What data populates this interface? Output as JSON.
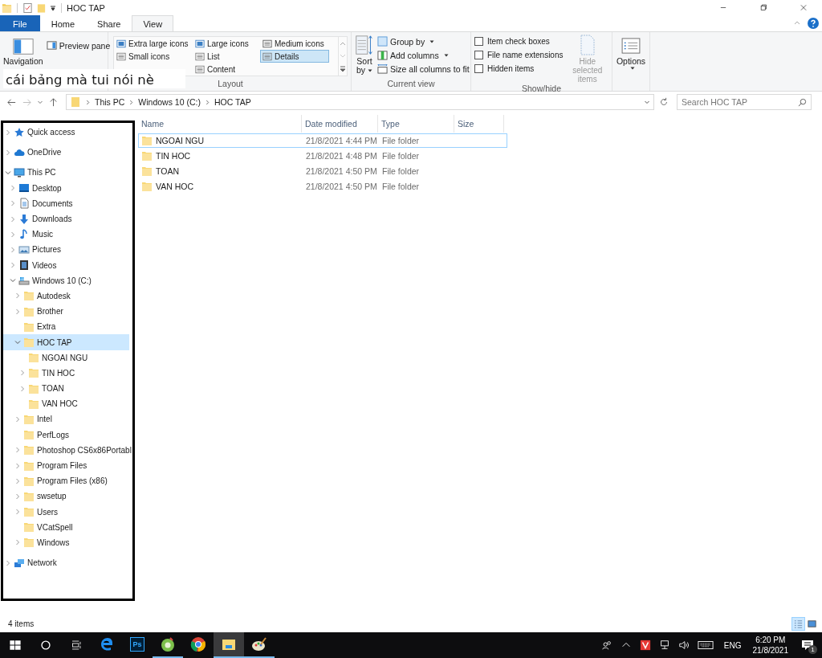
{
  "window": {
    "title": "HOC TAP"
  },
  "ribbon_tabs": [
    {
      "label": "File",
      "kind": "file",
      "selected": false
    },
    {
      "label": "Home",
      "kind": "tab",
      "selected": false
    },
    {
      "label": "Share",
      "kind": "tab",
      "selected": false
    },
    {
      "label": "View",
      "kind": "tab",
      "selected": true
    }
  ],
  "annotation": {
    "text": "cái bảng mà tui nói nè"
  },
  "panes_group": {
    "navigation_pane": "Navigation",
    "preview_pane": "Preview pane"
  },
  "layout_group": {
    "label": "Layout",
    "options": [
      {
        "label": "Extra large icons",
        "kind": "xl",
        "selected": false
      },
      {
        "label": "Large icons",
        "kind": "large",
        "selected": false
      },
      {
        "label": "Medium icons",
        "kind": "medium",
        "selected": false
      },
      {
        "label": "Small icons",
        "kind": "small",
        "selected": false
      },
      {
        "label": "List",
        "kind": "list",
        "selected": false
      },
      {
        "label": "Details",
        "kind": "details",
        "selected": true
      },
      {
        "label": "Content",
        "kind": "content",
        "selected": false
      }
    ]
  },
  "current_view_group": {
    "label": "Current view",
    "sort_by": "Sort",
    "sort_by_2": "by",
    "group_by": "Group by",
    "add_columns": "Add columns",
    "size_columns": "Size all columns to fit"
  },
  "show_hide_group": {
    "label": "Show/hide",
    "checkboxes": [
      {
        "label": "Item check boxes",
        "checked": false
      },
      {
        "label": "File name extensions",
        "checked": false
      },
      {
        "label": "Hidden items",
        "checked": false
      }
    ],
    "hide_selected": "Hide selected items"
  },
  "options_button": "Options",
  "address_bar": {
    "path": [
      "This PC",
      "Windows 10 (C:)",
      "HOC TAP"
    ]
  },
  "search": {
    "placeholder": "Search HOC TAP"
  },
  "nav_tree": [
    {
      "label": "Quick access",
      "kind": "star",
      "expanded": false
    },
    {
      "label": "OneDrive",
      "kind": "cloud",
      "expanded": false
    },
    {
      "label": "This PC",
      "kind": "pc",
      "expanded": true,
      "children": [
        {
          "label": "Desktop",
          "kind": "desktop",
          "expanded": false
        },
        {
          "label": "Documents",
          "kind": "documents",
          "expanded": false
        },
        {
          "label": "Downloads",
          "kind": "downloads",
          "expanded": false
        },
        {
          "label": "Music",
          "kind": "music",
          "expanded": false
        },
        {
          "label": "Pictures",
          "kind": "pictures",
          "expanded": false
        },
        {
          "label": "Videos",
          "kind": "videos",
          "expanded": false
        },
        {
          "label": "Windows 10 (C:)",
          "kind": "drive",
          "expanded": true,
          "children": [
            {
              "label": "Autodesk",
              "kind": "folder",
              "expanded": false
            },
            {
              "label": "Brother",
              "kind": "folder",
              "expanded": false
            },
            {
              "label": "Extra",
              "kind": "folder"
            },
            {
              "label": "HOC TAP",
              "kind": "folder",
              "expanded": true,
              "selected": true,
              "children": [
                {
                  "label": "NGOAI NGU",
                  "kind": "folder"
                },
                {
                  "label": "TIN HOC",
                  "kind": "folder",
                  "expanded": false
                },
                {
                  "label": "TOAN",
                  "kind": "folder",
                  "expanded": false
                },
                {
                  "label": "VAN HOC",
                  "kind": "folder"
                }
              ]
            },
            {
              "label": "Intel",
              "kind": "folder",
              "expanded": false
            },
            {
              "label": "PerfLogs",
              "kind": "folder"
            },
            {
              "label": "Photoshop CS6x86Portabl",
              "kind": "folder",
              "expanded": false
            },
            {
              "label": "Program Files",
              "kind": "folder",
              "expanded": false
            },
            {
              "label": "Program Files (x86)",
              "kind": "folder",
              "expanded": false
            },
            {
              "label": "swsetup",
              "kind": "folder",
              "expanded": false
            },
            {
              "label": "Users",
              "kind": "folder",
              "expanded": false
            },
            {
              "label": "VCatSpell",
              "kind": "folder"
            },
            {
              "label": "Windows",
              "kind": "folder",
              "expanded": false
            }
          ]
        }
      ]
    },
    {
      "label": "Network",
      "kind": "network",
      "expanded": false
    }
  ],
  "file_list": {
    "columns": [
      "Name",
      "Date modified",
      "Type",
      "Size"
    ],
    "rows": [
      {
        "name": "NGOAI NGU",
        "date_modified": "21/8/2021 4:44 PM",
        "type": "File folder",
        "focused": true
      },
      {
        "name": "TIN HOC",
        "date_modified": "21/8/2021 4:48 PM",
        "type": "File folder",
        "focused": false
      },
      {
        "name": "TOAN",
        "date_modified": "21/8/2021 4:50 PM",
        "type": "File folder",
        "focused": false
      },
      {
        "name": "VAN HOC",
        "date_modified": "21/8/2021 4:50 PM",
        "type": "File folder",
        "focused": false
      }
    ]
  },
  "status_bar": {
    "item_count": "4 items",
    "view_buttons": [
      {
        "kind": "details",
        "selected": true
      },
      {
        "kind": "large",
        "selected": false
      }
    ]
  },
  "taskbar": {
    "apps": [
      {
        "kind": "edge",
        "running": false,
        "active": false
      },
      {
        "kind": "photoshop",
        "label": "Ps",
        "running": false,
        "active": false
      },
      {
        "kind": "green",
        "running": true,
        "active": false
      },
      {
        "kind": "chrome",
        "running": false,
        "active": false
      },
      {
        "kind": "explorer",
        "running": true,
        "active": true
      },
      {
        "kind": "paint",
        "running": true,
        "active": false
      }
    ],
    "language": "ENG",
    "time": "6:20 PM",
    "date": "21/8/2021",
    "notification_count": "1"
  }
}
